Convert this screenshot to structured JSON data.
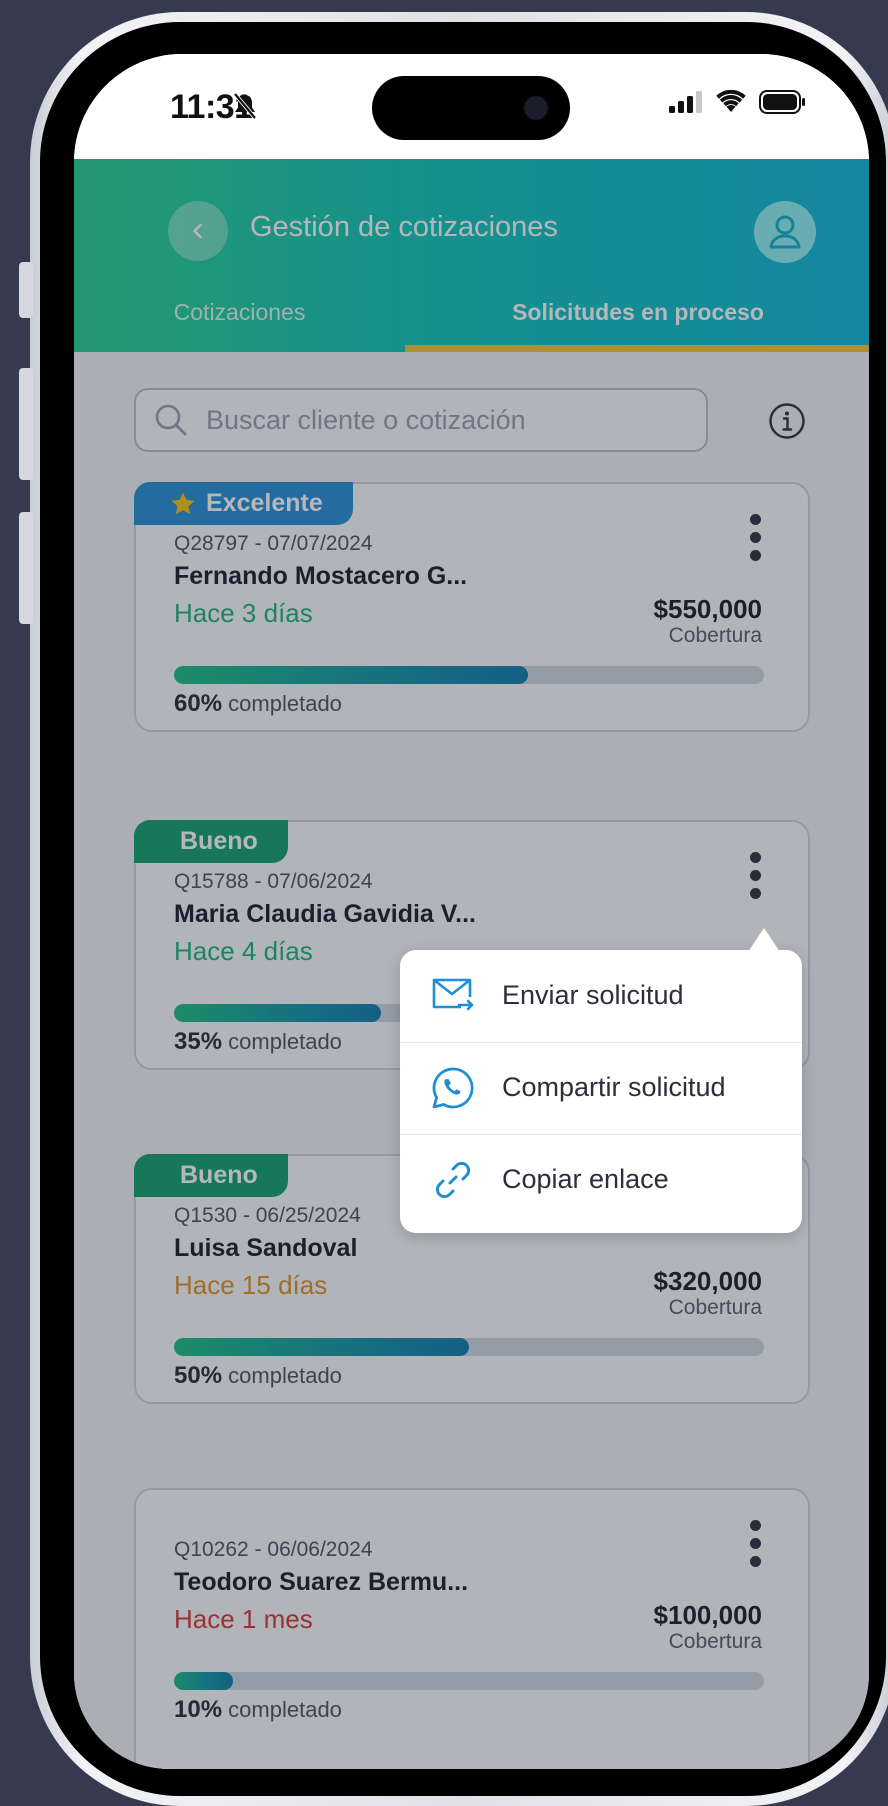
{
  "status_bar": {
    "time": "11:31"
  },
  "header": {
    "title": "Gestión de cotizaciones",
    "tabs": [
      {
        "label": "Cotizaciones",
        "active": false
      },
      {
        "label": "Solicitudes en proceso",
        "active": true
      }
    ]
  },
  "search": {
    "placeholder": "Buscar cliente o cotización"
  },
  "cards": [
    {
      "badge": "Excelente",
      "id_date": "Q28797 - 07/07/2024",
      "name": "Fernando Mostacero G...",
      "time_ago": "Hace 3 días",
      "amount": "$550,000",
      "amount_label": "Cobertura",
      "progress": 0.6,
      "progress_pct": "60%",
      "progress_suffix": "completado"
    },
    {
      "badge": "Bueno",
      "id_date": "Q15788 - 07/06/2024",
      "name": "Maria Claudia Gavidia V...",
      "time_ago": "Hace 4 días",
      "progress": 0.35,
      "progress_pct": "35%",
      "progress_suffix": "completado"
    },
    {
      "badge": "Bueno",
      "id_date": "Q1530 - 06/25/2024",
      "name": "Luisa Sandoval",
      "time_ago": "Hace 15 días",
      "amount": "$320,000",
      "amount_label": "Cobertura",
      "progress": 0.5,
      "progress_pct": "50%",
      "progress_suffix": "completado"
    },
    {
      "id_date": "Q10262 - 06/06/2024",
      "name": "Teodoro Suarez Bermu...",
      "time_ago": "Hace 1 mes",
      "amount": "$100,000",
      "amount_label": "Cobertura",
      "progress": 0.1,
      "progress_pct": "10%",
      "progress_suffix": "completado"
    }
  ],
  "menu": {
    "items": [
      {
        "label": "Enviar solicitud",
        "icon": "mail-send-icon"
      },
      {
        "label": "Compartir solicitud",
        "icon": "whatsapp-icon"
      },
      {
        "label": "Copiar enlace",
        "icon": "link-icon"
      }
    ]
  },
  "colors": {
    "header_gradient_start": "#2bd293",
    "header_gradient_end": "#12b9d8",
    "tab_underline": "#f3c43a",
    "badge_excellent": "#2a8fd6",
    "badge_good": "#16a36f",
    "time_recent": "#1fb37a",
    "time_medium": "#e0922c",
    "time_old": "#d83a3a"
  }
}
